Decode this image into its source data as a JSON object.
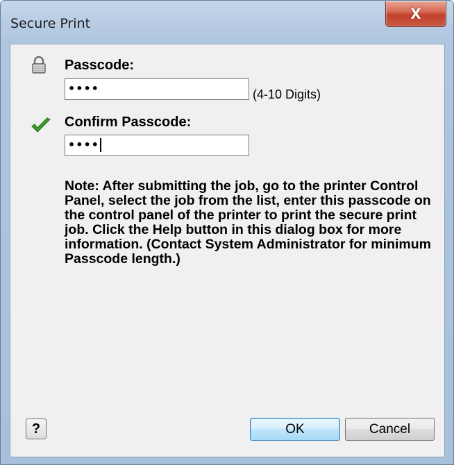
{
  "window": {
    "title": "Secure Print",
    "close_label": "X"
  },
  "passcode": {
    "label": "Passcode:",
    "value": "••••",
    "hint": "(4-10 Digits)"
  },
  "confirm": {
    "label": "Confirm Passcode:",
    "value": "••••"
  },
  "note": {
    "text": "Note: After submitting the job, go to the printer Control Panel, select the job from the list, enter this passcode on the control panel of the printer to print the secure print job. Click the Help button in this dialog box for more information. (Contact System Administrator for minimum Passcode length.)"
  },
  "buttons": {
    "help": "?",
    "ok": "OK",
    "cancel": "Cancel"
  },
  "icons": {
    "lock": "lock-icon",
    "check": "checkmark-icon"
  },
  "colors": {
    "check_green": "#3a9b2b",
    "close_red": "#c7432c"
  }
}
